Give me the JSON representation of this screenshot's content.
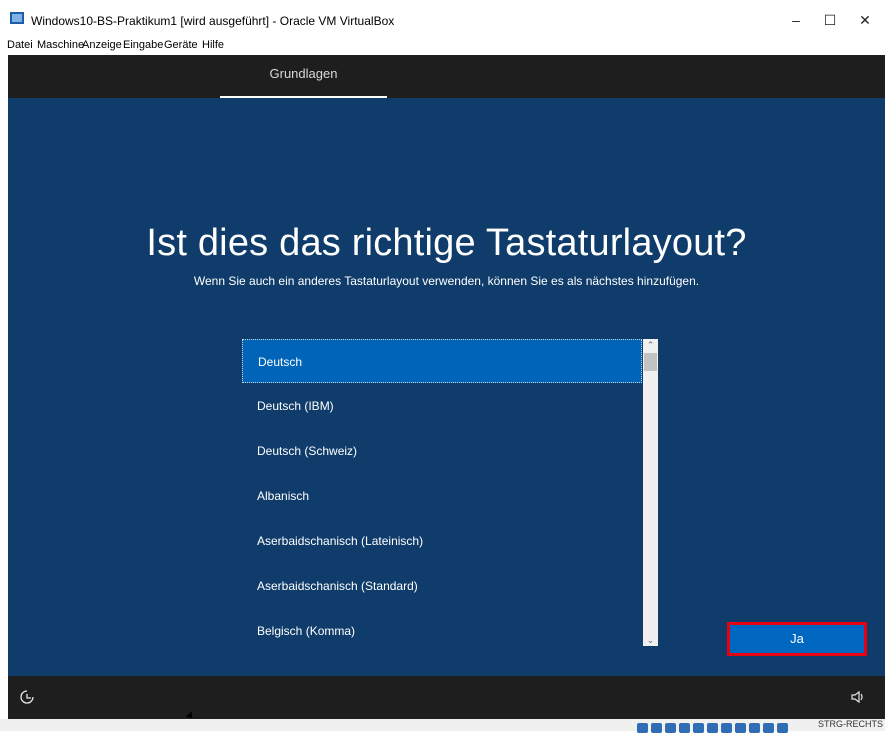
{
  "window": {
    "title": "Windows10-BS-Praktikum1 [wird ausgeführt] - Oracle VM VirtualBox",
    "minimize": "–",
    "maximize": "☐",
    "close": "✕"
  },
  "menu": {
    "items": [
      "Datei",
      "Maschine",
      "Anzeige",
      "Eingabe",
      "Geräte",
      "Hilfe"
    ]
  },
  "setup": {
    "tab": "Grundlagen",
    "heading": "Ist dies das richtige Tastaturlayout?",
    "subheading": "Wenn Sie auch ein anderes Tastaturlayout verwenden, können Sie es als nächstes hinzufügen.",
    "layouts": [
      "Deutsch",
      "Deutsch (IBM)",
      "Deutsch (Schweiz)",
      "Albanisch",
      "Aserbaidschanisch (Lateinisch)",
      "Aserbaidschanisch (Standard)",
      "Belgisch (Komma)"
    ],
    "selected_index": 0,
    "confirm_label": "Ja"
  },
  "status": {
    "host_key": "STRG-RECHTS"
  },
  "colors": {
    "background": "#0f3c6b",
    "selected": "#0065b8",
    "button": "#0067c0",
    "highlight_border": "#e60012",
    "band": "#1e1e1e"
  },
  "icons": {
    "accessibility": "accessibility-icon",
    "volume": "volume-icon"
  }
}
